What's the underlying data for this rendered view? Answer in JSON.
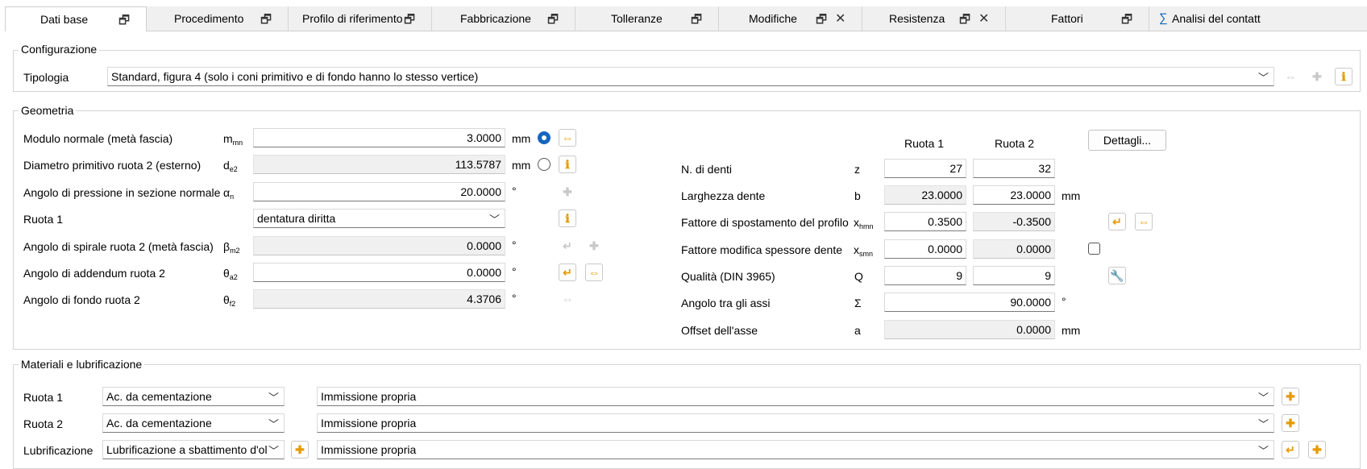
{
  "tabs": [
    {
      "label": "Dati base"
    },
    {
      "label": "Procedimento"
    },
    {
      "label": "Profilo di riferimento"
    },
    {
      "label": "Fabbricazione"
    },
    {
      "label": "Tolleranze"
    },
    {
      "label": "Modifiche"
    },
    {
      "label": "Resistenza"
    },
    {
      "label": "Fattori"
    },
    {
      "label": "Analisi del contatt"
    }
  ],
  "configurazione": {
    "title": "Configurazione",
    "tipologia_label": "Tipologia",
    "tipologia_value": "Standard, figura 4 (solo i coni primitivo e di fondo hanno lo stesso vertice)"
  },
  "geometria": {
    "title": "Geometria",
    "rows": [
      {
        "label": "Modulo normale (metà fascia)",
        "sym": "m",
        "sub": "mn",
        "value": "3.0000",
        "unit": "mm"
      },
      {
        "label": "Diametro primitivo ruota 2 (esterno)",
        "sym": "d",
        "sub": "e2",
        "value": "113.5787",
        "unit": "mm"
      },
      {
        "label": "Angolo di pressione in sezione normale",
        "sym": "α",
        "sub": "n",
        "value": "20.0000",
        "unit": "°"
      },
      {
        "label": "Ruota 1",
        "sym": "",
        "sub": "",
        "value": "dentatura diritta",
        "unit": ""
      },
      {
        "label": "Angolo di spirale ruota 2 (metà fascia)",
        "sym": "β",
        "sub": "m2",
        "value": "0.0000",
        "unit": "°"
      },
      {
        "label": "Angolo di addendum ruota 2",
        "sym": "θ",
        "sub": "a2",
        "value": "0.0000",
        "unit": "°"
      },
      {
        "label": "Angolo di fondo ruota 2",
        "sym": "θ",
        "sub": "f2",
        "value": "4.3706",
        "unit": "°"
      }
    ],
    "col_ruota1": "Ruota 1",
    "col_ruota2": "Ruota 2",
    "dettagli_label": "Dettagli...",
    "right_rows": [
      {
        "label": "N. di denti",
        "sym": "z",
        "sub": "",
        "v1": "27",
        "v2": "32",
        "unit": ""
      },
      {
        "label": "Larghezza dente",
        "sym": "b",
        "sub": "",
        "v1": "23.0000",
        "v2": "23.0000",
        "unit": "mm"
      },
      {
        "label": "Fattore di spostamento del profilo",
        "sym": "x",
        "sub": "hmn",
        "v1": "0.3500",
        "v2": "-0.3500",
        "unit": ""
      },
      {
        "label": "Fattore modifica spessore dente",
        "sym": "x",
        "sub": "smn",
        "v1": "0.0000",
        "v2": "0.0000",
        "unit": ""
      },
      {
        "label": "Qualità (DIN 3965)",
        "sym": "Q",
        "sub": "",
        "v1": "9",
        "v2": "9",
        "unit": ""
      },
      {
        "label": "Angolo tra gli assi",
        "sym": "Σ",
        "sub": "",
        "v": "90.0000",
        "unit": "°"
      },
      {
        "label": "Offset dell'asse",
        "sym": "a",
        "sub": "",
        "v": "0.0000",
        "unit": "mm"
      }
    ]
  },
  "materiali": {
    "title": "Materiali e lubrificazione",
    "rows": [
      {
        "label": "Ruota 1",
        "value": "Ac. da cementazione",
        "source": "Immissione propria"
      },
      {
        "label": "Ruota 2",
        "value": "Ac. da cementazione",
        "source": "Immissione propria"
      },
      {
        "label": "Lubrificazione",
        "value": "Lubrificazione a sbattimento d'ol",
        "source": "Immissione propria"
      }
    ]
  },
  "icons": {
    "window": "restore-window-icon",
    "close": "close-icon",
    "sum": "sum-icon",
    "info": "info-icon",
    "plus": "plus-icon",
    "arrows": "arrows-icon",
    "arrow_left": "arrow-left-icon",
    "wrench": "wrench-icon",
    "chevron": "chevron-down-icon"
  },
  "colors": {
    "accent": "#1565c0",
    "icon_orange": "#e69a00"
  }
}
